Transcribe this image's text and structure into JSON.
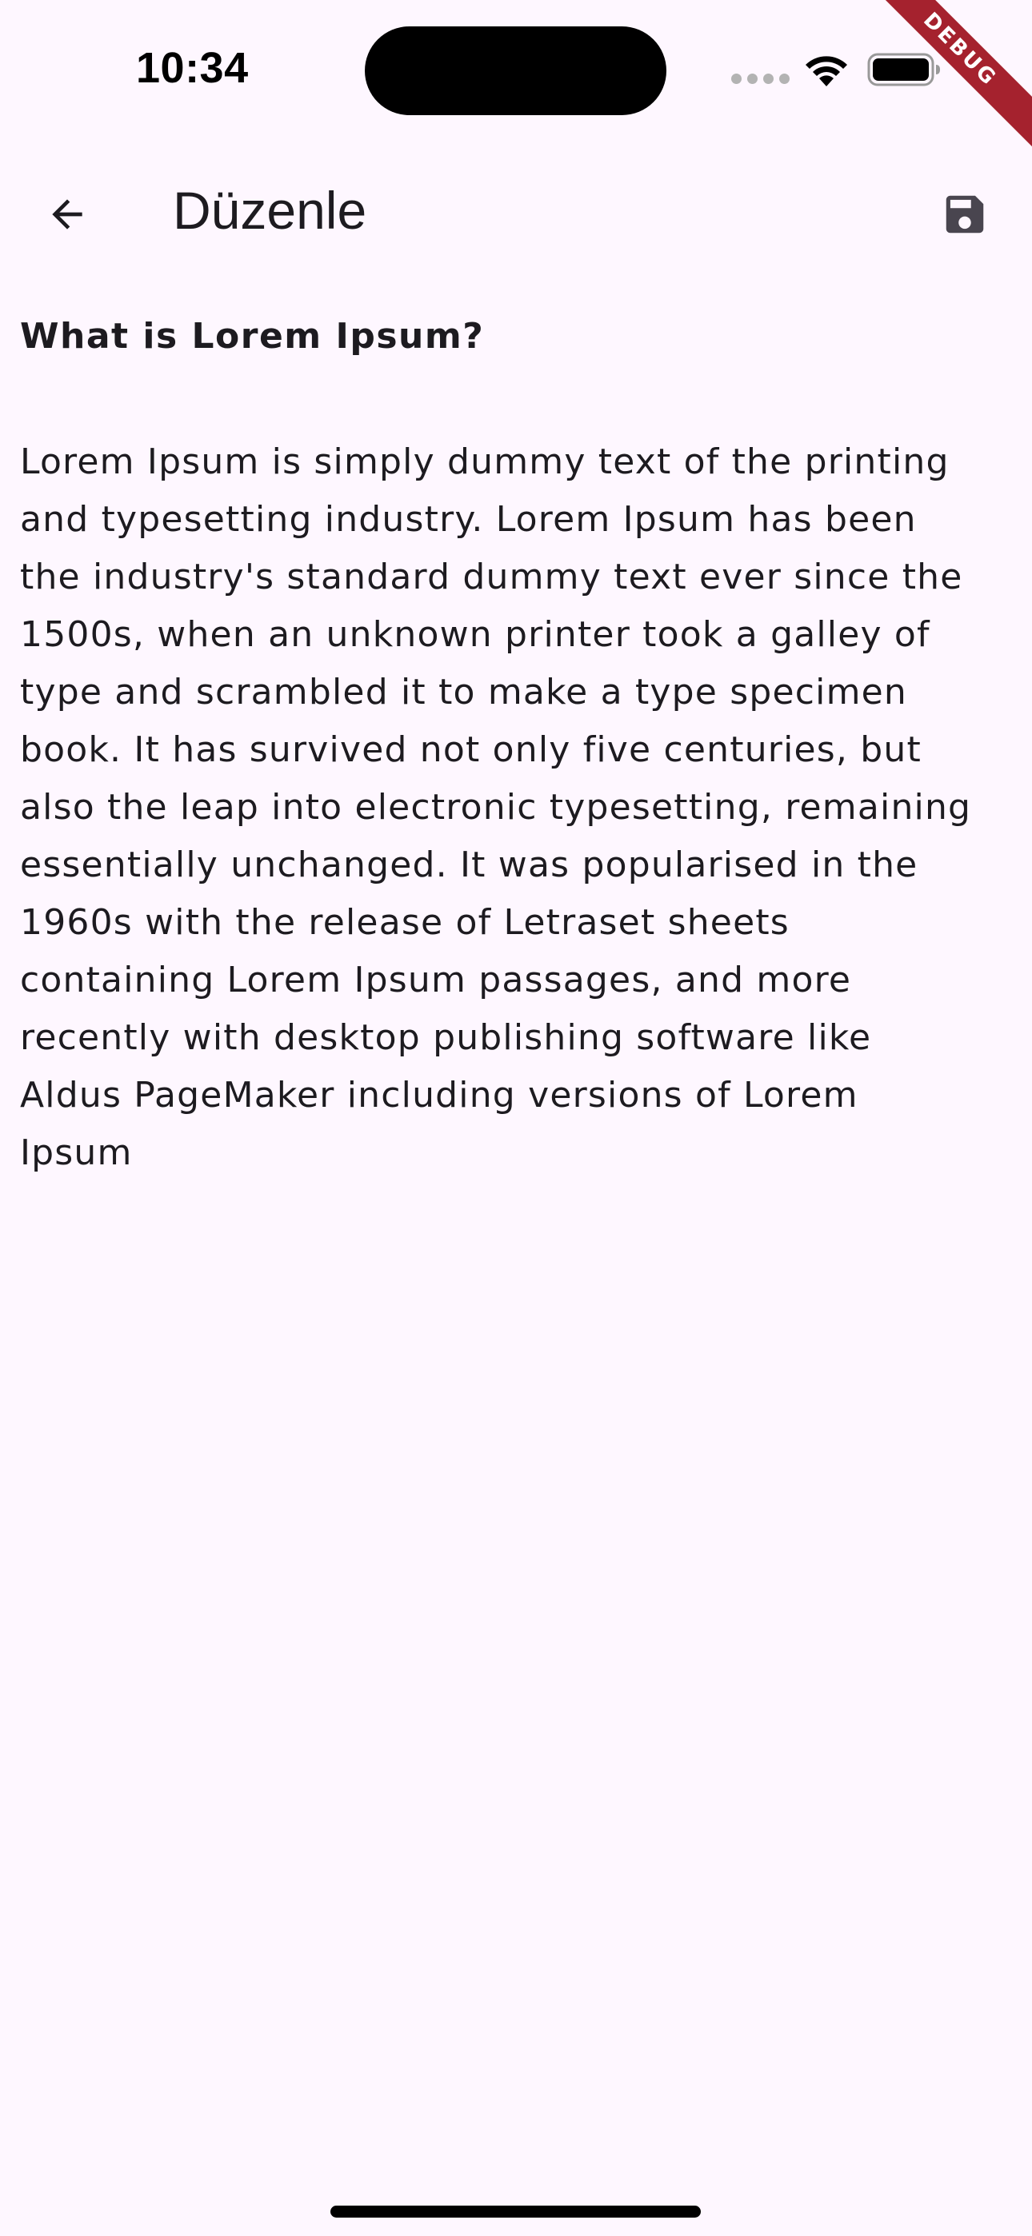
{
  "status_bar": {
    "time": "10:34"
  },
  "debug_banner": {
    "label": "DEBUG",
    "color": "#A5222E"
  },
  "app_bar": {
    "back_icon": "arrow-back-icon",
    "title": "Düzenle",
    "save_icon": "save-icon"
  },
  "note": {
    "title": "What is Lorem Ipsum?",
    "body": "Lorem Ipsum is simply dummy text of the printing\nand typesetting industry. Lorem Ipsum has been\nthe industry's standard dummy text ever since the\n1500s, when an unknown printer took a galley of\ntype and scrambled it to make a type specimen\nbook. It has survived not only five centuries, but\nalso the leap into electronic typesetting, remaining\nessentially unchanged. It was popularised in the\n1960s with the release of Letraset sheets\ncontaining Lorem Ipsum passages, and more\nrecently with desktop publishing software like\nAldus PageMaker including versions of Lorem\nIpsum"
  },
  "colors": {
    "background": "#FEF7FF",
    "text": "#1d1b20"
  }
}
